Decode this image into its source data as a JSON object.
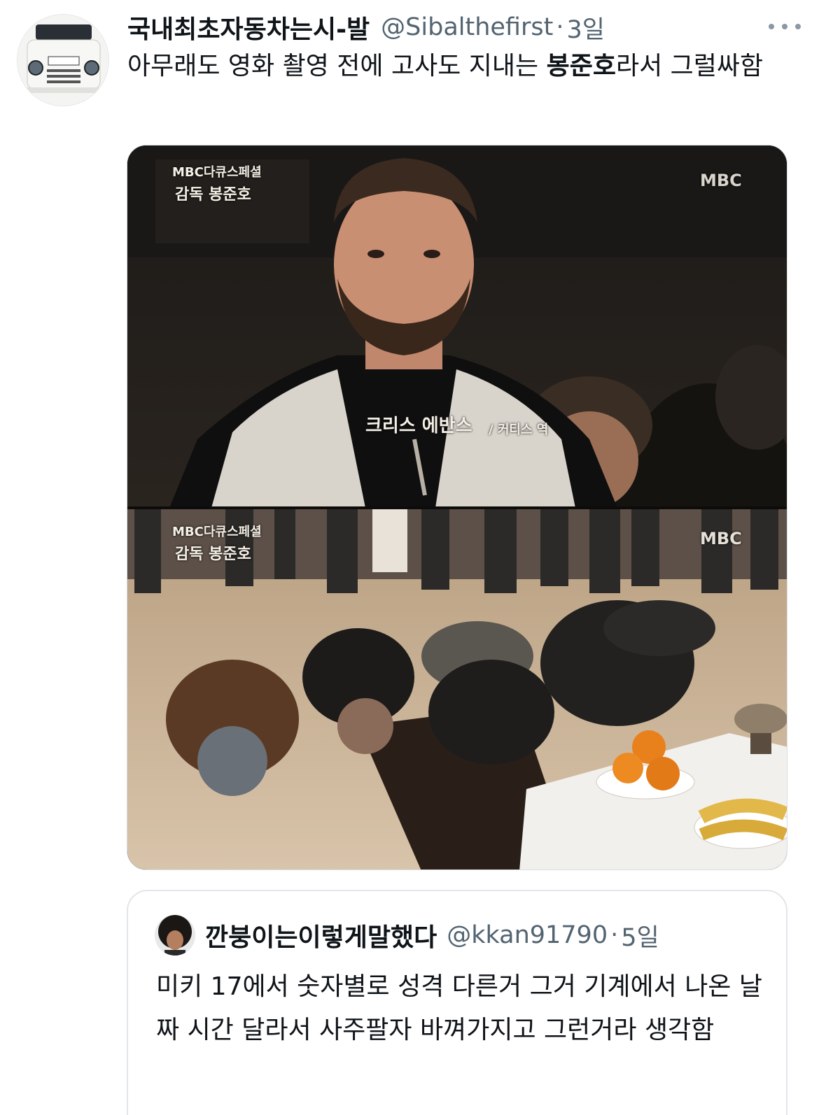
{
  "tweet": {
    "display_name": "국내최초자동차는시-발",
    "handle": "@Sibalthefirst",
    "separator": "·",
    "time": "3일",
    "text_before": "아무래도 영화 촬영 전에 고사도 지내는 ",
    "text_bold": "봉준호",
    "text_after": "라서 그럴싸함"
  },
  "media": {
    "top_logo": "MBC다큐스페셜",
    "top_subtitle": "감독 봉준호",
    "broadcaster": "MBC",
    "caption_name": "크리스 에반스",
    "caption_role": "/ 커티스 역",
    "bottom_logo": "MBC다큐스페셜",
    "bottom_subtitle": "감독 봉준호",
    "bottom_broadcaster": "MBC"
  },
  "quote": {
    "display_name": "깐붕이는이렇게말했다",
    "handle": "@kkan91790",
    "separator": "·",
    "time": "5일",
    "text": "미키 17에서 숫자별로 성격 다른거 그거 기계에서 나온 날짜 시간 달라서 사주팔자 바껴가지고 그런거라 생각함"
  }
}
